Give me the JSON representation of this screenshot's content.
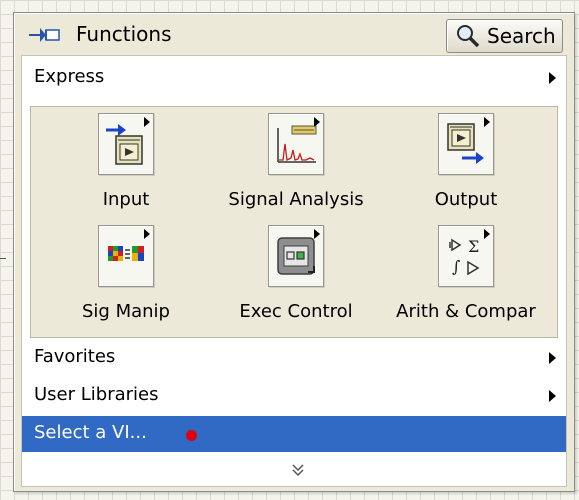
{
  "window": {
    "title": "Functions",
    "search_label": "Search"
  },
  "menu": {
    "express_label": "Express",
    "categories": [
      {
        "label": "Input",
        "icon": "input-icon"
      },
      {
        "label": "Signal Analysis",
        "icon": "signal-analysis-icon"
      },
      {
        "label": "Output",
        "icon": "output-icon"
      },
      {
        "label": "Sig Manip",
        "icon": "sig-manip-icon"
      },
      {
        "label": "Exec Control",
        "icon": "exec-control-icon"
      },
      {
        "label": "Arith & Compar",
        "icon": "arith-compar-icon"
      }
    ],
    "favorites_label": "Favorites",
    "user_libraries_label": "User Libraries",
    "select_vi_label": "Select a VI..."
  },
  "colors": {
    "palette_bg": "#ece9d8",
    "selection": "#316ac5",
    "cursor_dot": "#e0000f"
  }
}
